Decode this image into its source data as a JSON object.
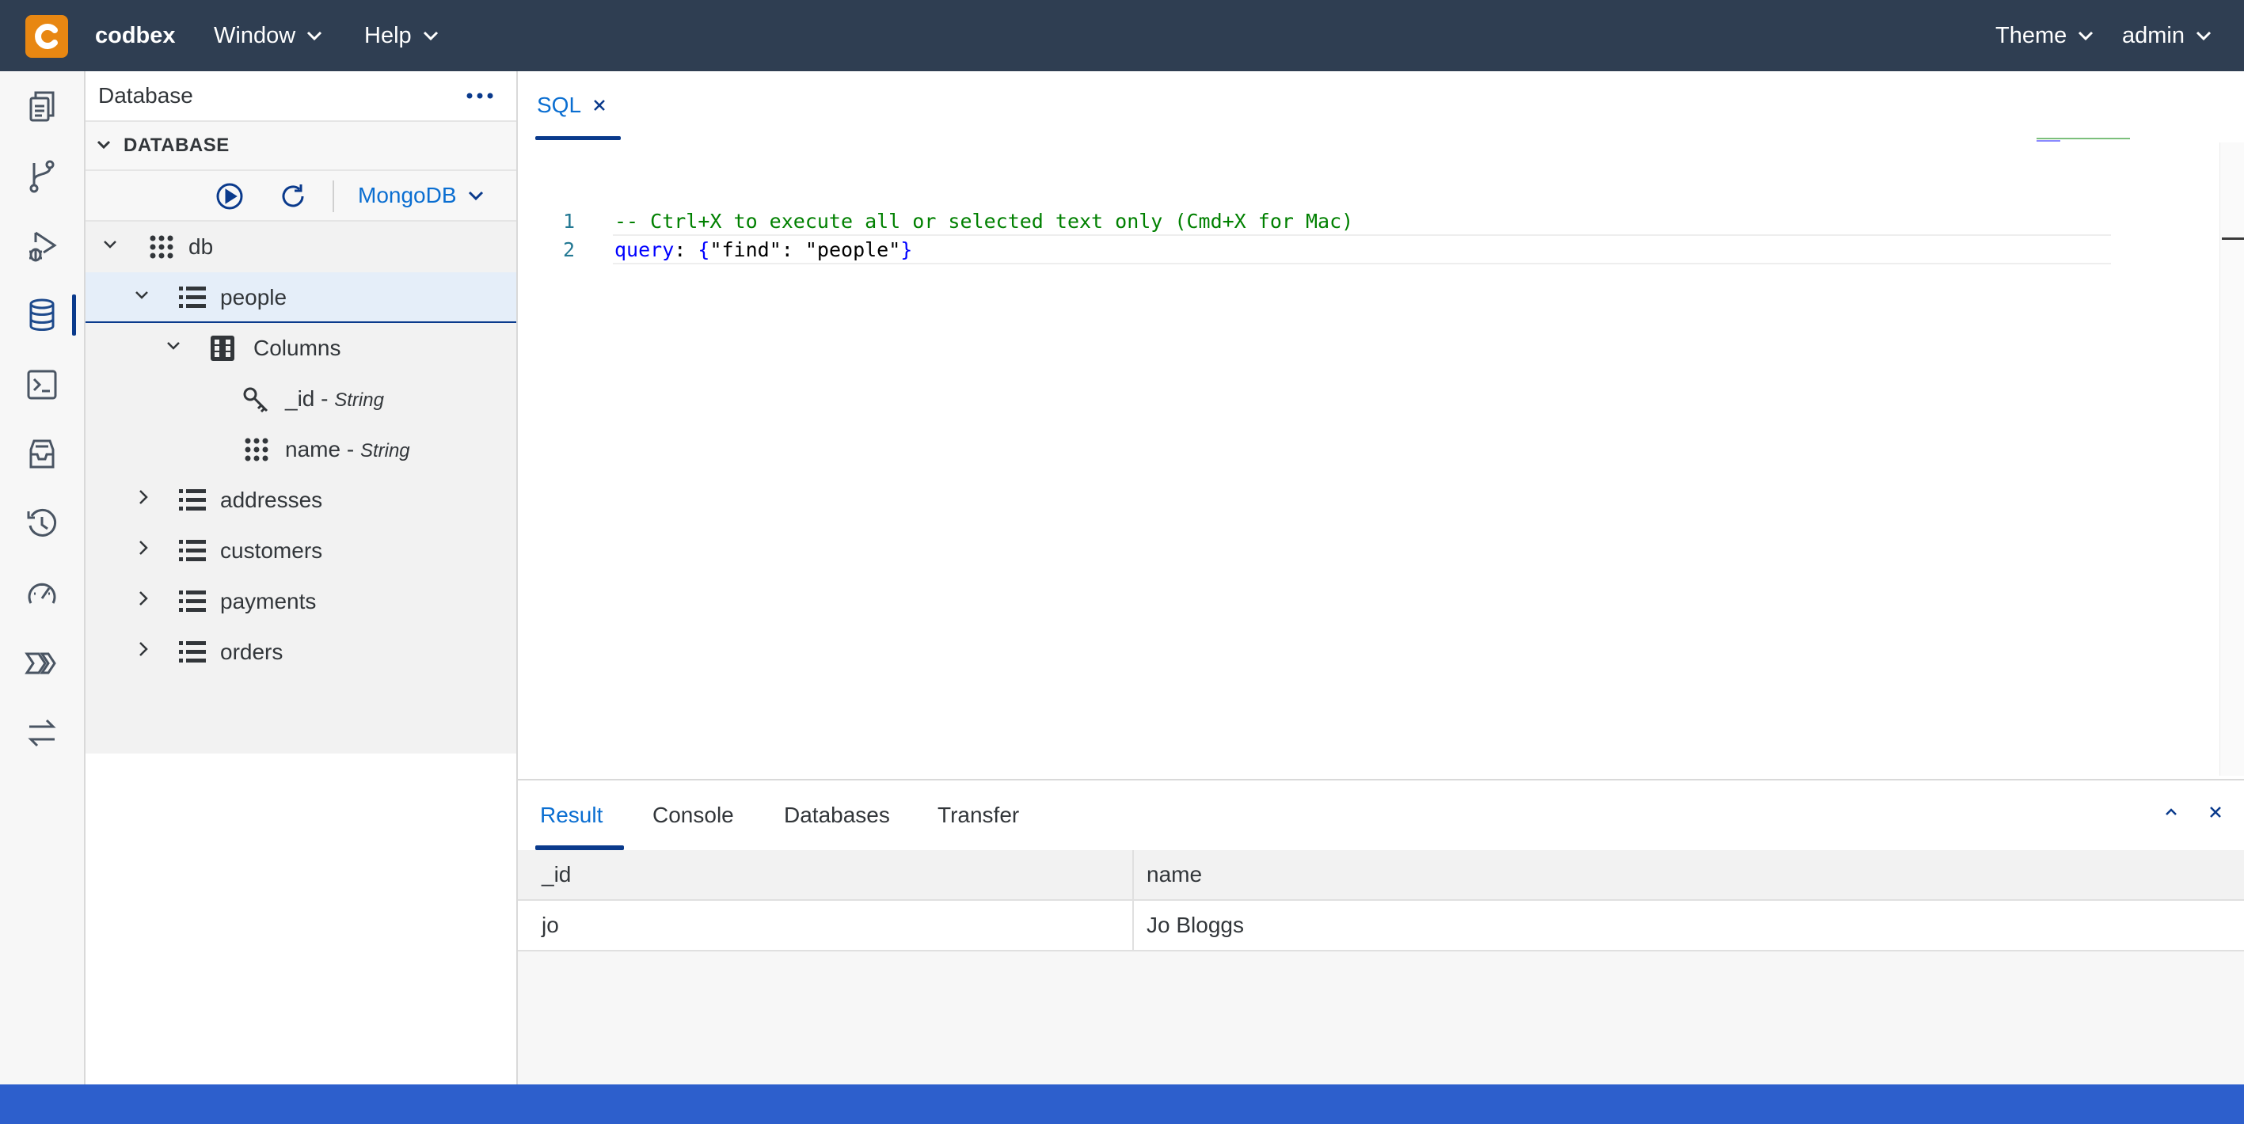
{
  "app": {
    "brand": "codbex"
  },
  "topbar": {
    "menus": [
      {
        "label": "Window"
      },
      {
        "label": "Help"
      }
    ],
    "right": [
      {
        "label": "Theme"
      },
      {
        "label": "admin"
      }
    ]
  },
  "activity": {
    "icons": [
      "files-icon",
      "git-branch-icon",
      "debug-icon",
      "database-icon",
      "terminal-icon",
      "inbox-icon",
      "history-icon",
      "gauge-icon",
      "process-icon",
      "transfer-icon"
    ],
    "active": "database-icon"
  },
  "sidebar": {
    "title": "Database",
    "section_title": "DATABASE",
    "datasource": "MongoDB",
    "tree": {
      "db": {
        "label": "db"
      },
      "people": {
        "label": "people"
      },
      "columns": {
        "label": "Columns"
      },
      "col_id": {
        "name": "_id - ",
        "type": "String"
      },
      "col_name": {
        "name": "name - ",
        "type": "String"
      },
      "addresses": {
        "label": "addresses"
      },
      "customers": {
        "label": "customers"
      },
      "payments": {
        "label": "payments"
      },
      "orders": {
        "label": "orders"
      }
    }
  },
  "editor": {
    "tab_label": "SQL",
    "lines": [
      {
        "num": "1",
        "text": "-- Ctrl+X to execute all or selected text only (Cmd+X for Mac)"
      },
      {
        "num": "2",
        "key": "query",
        "colon": ": ",
        "open": "{",
        "pair_key": "\"find\"",
        "pair_sep": ": ",
        "pair_val": "\"people\"",
        "close": "}"
      }
    ],
    "colors": {
      "comment": "#008000",
      "keyword": "#0000ff",
      "text": "#000000",
      "linenum": "#237893"
    }
  },
  "panel": {
    "tabs": [
      {
        "label": "Result",
        "active": true
      },
      {
        "label": "Console"
      },
      {
        "label": "Databases"
      },
      {
        "label": "Transfer"
      }
    ],
    "result": {
      "columns": [
        "_id",
        "name"
      ],
      "rows": [
        [
          "jo",
          "Jo Bloggs"
        ]
      ]
    }
  },
  "colors": {
    "topbar": "#2f3e52",
    "accent": "#0a6ed1",
    "logo": "#e88712",
    "statusbar": "#2d5fcc"
  }
}
